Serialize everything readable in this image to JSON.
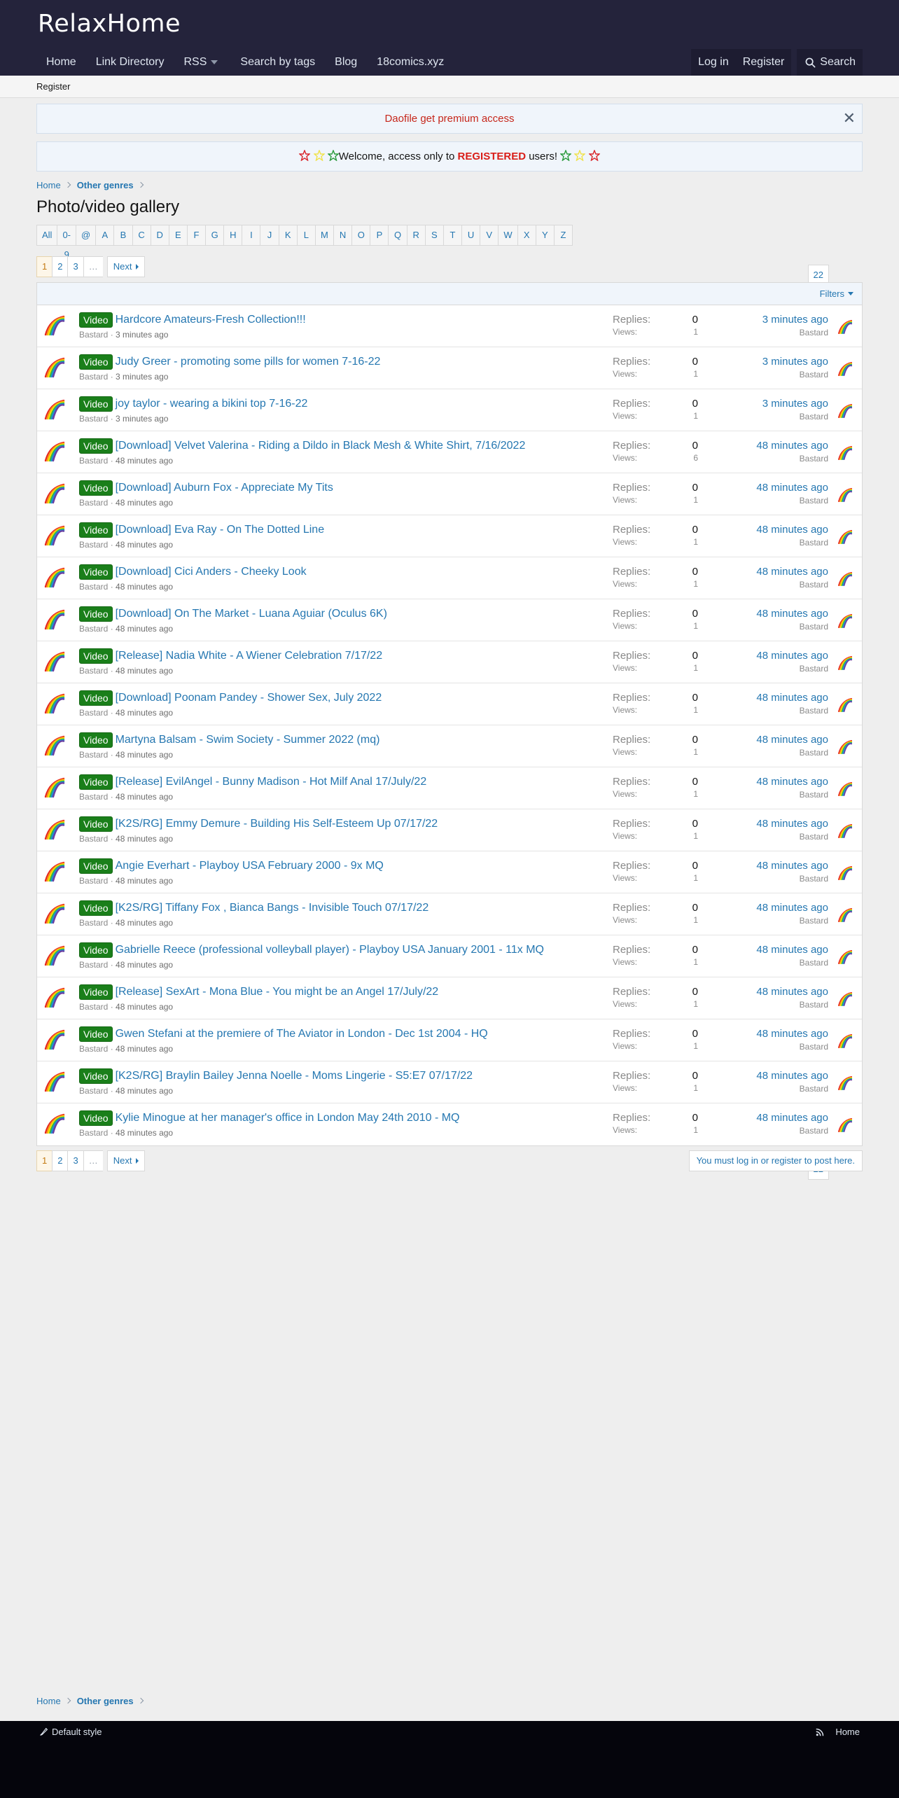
{
  "site": {
    "logo": "RelaxHome"
  },
  "nav": {
    "items": [
      "Home",
      "Link Directory",
      "RSS",
      "Search by tags",
      "Blog",
      "18comics.xyz"
    ],
    "login": "Log in",
    "register": "Register",
    "search": "Search"
  },
  "subnav": {
    "register": "Register"
  },
  "notices": {
    "premium": "Daofile get premium access",
    "welcome_pre": "Welcome, access only to",
    "welcome_strong": "REGISTERED",
    "welcome_post": "users!"
  },
  "breadcrumb": {
    "home": "Home",
    "section": "Other genres"
  },
  "page": {
    "title": "Photo/video gallery"
  },
  "letters": [
    "All",
    "0-9",
    "@",
    "A",
    "B",
    "C",
    "D",
    "E",
    "F",
    "G",
    "H",
    "I",
    "J",
    "K",
    "L",
    "M",
    "N",
    "O",
    "P",
    "Q",
    "R",
    "S",
    "T",
    "U",
    "V",
    "W",
    "X",
    "Y",
    "Z"
  ],
  "pager": {
    "pages": [
      "1",
      "2",
      "3",
      "…",
      "22"
    ],
    "next": "Next"
  },
  "filters": {
    "label": "Filters"
  },
  "labels": {
    "replies": "Replies:",
    "views": "Views:",
    "sep": "·"
  },
  "threads": [
    {
      "badge": "Video",
      "title": "Hardcore Amateurs-Fresh Collection!!!",
      "author": "Bastard",
      "time": "3 minutes ago",
      "replies": "0",
      "views": "1",
      "last_time": "3 minutes ago",
      "last_user": "Bastard"
    },
    {
      "badge": "Video",
      "title": "Judy Greer - promoting some pills for women 7-16-22",
      "author": "Bastard",
      "time": "3 minutes ago",
      "replies": "0",
      "views": "1",
      "last_time": "3 minutes ago",
      "last_user": "Bastard"
    },
    {
      "badge": "Video",
      "title": "joy taylor - wearing a bikini top 7-16-22",
      "author": "Bastard",
      "time": "3 minutes ago",
      "replies": "0",
      "views": "1",
      "last_time": "3 minutes ago",
      "last_user": "Bastard"
    },
    {
      "badge": "Video",
      "title": "[Download] Velvet Valerina - Riding a Dildo in Black Mesh & White Shirt, 7/16/2022",
      "author": "Bastard",
      "time": "48 minutes ago",
      "replies": "0",
      "views": "6",
      "last_time": "48 minutes ago",
      "last_user": "Bastard"
    },
    {
      "badge": "Video",
      "title": "[Download] Auburn Fox - Appreciate My Tits",
      "author": "Bastard",
      "time": "48 minutes ago",
      "replies": "0",
      "views": "1",
      "last_time": "48 minutes ago",
      "last_user": "Bastard"
    },
    {
      "badge": "Video",
      "title": "[Download] Eva Ray - On The Dotted Line",
      "author": "Bastard",
      "time": "48 minutes ago",
      "replies": "0",
      "views": "1",
      "last_time": "48 minutes ago",
      "last_user": "Bastard"
    },
    {
      "badge": "Video",
      "title": "[Download] Cici Anders - Cheeky Look",
      "author": "Bastard",
      "time": "48 minutes ago",
      "replies": "0",
      "views": "1",
      "last_time": "48 minutes ago",
      "last_user": "Bastard"
    },
    {
      "badge": "Video",
      "title": "[Download] On The Market - Luana Aguiar (Oculus 6K)",
      "author": "Bastard",
      "time": "48 minutes ago",
      "replies": "0",
      "views": "1",
      "last_time": "48 minutes ago",
      "last_user": "Bastard"
    },
    {
      "badge": "Video",
      "title": "[Release] Nadia White - A Wiener Celebration 7/17/22",
      "author": "Bastard",
      "time": "48 minutes ago",
      "replies": "0",
      "views": "1",
      "last_time": "48 minutes ago",
      "last_user": "Bastard"
    },
    {
      "badge": "Video",
      "title": "[Download] Poonam Pandey - Shower Sex, July 2022",
      "author": "Bastard",
      "time": "48 minutes ago",
      "replies": "0",
      "views": "1",
      "last_time": "48 minutes ago",
      "last_user": "Bastard"
    },
    {
      "badge": "Video",
      "title": "Martyna Balsam - Swim Society - Summer 2022 (mq)",
      "author": "Bastard",
      "time": "48 minutes ago",
      "replies": "0",
      "views": "1",
      "last_time": "48 minutes ago",
      "last_user": "Bastard"
    },
    {
      "badge": "Video",
      "title": "[Release] EvilAngel - Bunny Madison - Hot Milf Anal 17/July/22",
      "author": "Bastard",
      "time": "48 minutes ago",
      "replies": "0",
      "views": "1",
      "last_time": "48 minutes ago",
      "last_user": "Bastard"
    },
    {
      "badge": "Video",
      "title": "[K2S/RG] Emmy Demure - Building His Self-Esteem Up 07/17/22",
      "author": "Bastard",
      "time": "48 minutes ago",
      "replies": "0",
      "views": "1",
      "last_time": "48 minutes ago",
      "last_user": "Bastard"
    },
    {
      "badge": "Video",
      "title": "Angie Everhart - Playboy USA February 2000 - 9x MQ",
      "author": "Bastard",
      "time": "48 minutes ago",
      "replies": "0",
      "views": "1",
      "last_time": "48 minutes ago",
      "last_user": "Bastard"
    },
    {
      "badge": "Video",
      "title": "[K2S/RG] Tiffany Fox , Bianca Bangs - Invisible Touch 07/17/22",
      "author": "Bastard",
      "time": "48 minutes ago",
      "replies": "0",
      "views": "1",
      "last_time": "48 minutes ago",
      "last_user": "Bastard"
    },
    {
      "badge": "Video",
      "title": "Gabrielle Reece (professional volleyball player) - Playboy USA January 2001 - 11x MQ",
      "author": "Bastard",
      "time": "48 minutes ago",
      "replies": "0",
      "views": "1",
      "last_time": "48 minutes ago",
      "last_user": "Bastard"
    },
    {
      "badge": "Video",
      "title": "[Release] SexArt - Mona Blue - You might be an Angel 17/July/22",
      "author": "Bastard",
      "time": "48 minutes ago",
      "replies": "0",
      "views": "1",
      "last_time": "48 minutes ago",
      "last_user": "Bastard"
    },
    {
      "badge": "Video",
      "title": "Gwen Stefani at the premiere of The Aviator in London - Dec 1st 2004 - HQ",
      "author": "Bastard",
      "time": "48 minutes ago",
      "replies": "0",
      "views": "1",
      "last_time": "48 minutes ago",
      "last_user": "Bastard"
    },
    {
      "badge": "Video",
      "title": "[K2S/RG] Braylin Bailey Jenna Noelle - Moms Lingerie - S5:E7 07/17/22",
      "author": "Bastard",
      "time": "48 minutes ago",
      "replies": "0",
      "views": "1",
      "last_time": "48 minutes ago",
      "last_user": "Bastard"
    },
    {
      "badge": "Video",
      "title": "Kylie Minogue at her manager's office in London May 24th 2010 - MQ",
      "author": "Bastard",
      "time": "48 minutes ago",
      "replies": "0",
      "views": "1",
      "last_time": "48 minutes ago",
      "last_user": "Bastard"
    }
  ],
  "post_notice": "You must log in or register to post here.",
  "footer": {
    "style": "Default style",
    "home": "Home"
  },
  "colors": {
    "header": "#24233b",
    "footer": "#05050c",
    "link": "#2577b1",
    "badge": "#1a7f1a",
    "notice_red": "#c6271b"
  }
}
